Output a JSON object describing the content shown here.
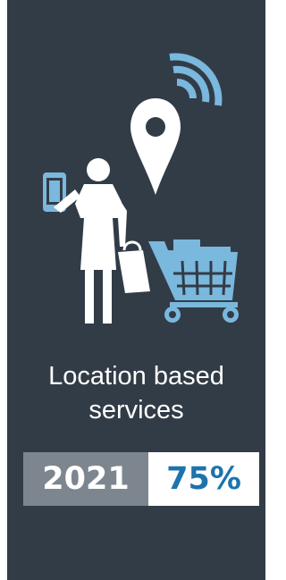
{
  "card": {
    "caption_line1": "Location based",
    "caption_line2": "services",
    "year": "2021",
    "percent": "75%"
  },
  "colors": {
    "panel_background": "#323c47",
    "accent_light_blue": "#7ab8dd",
    "year_box": "#7d868f",
    "percent_text": "#1c73ad"
  },
  "icons": [
    "phone-icon",
    "person-icon",
    "shopping-bag-icon",
    "location-pin-icon",
    "wifi-signal-icon",
    "shopping-cart-icon"
  ]
}
